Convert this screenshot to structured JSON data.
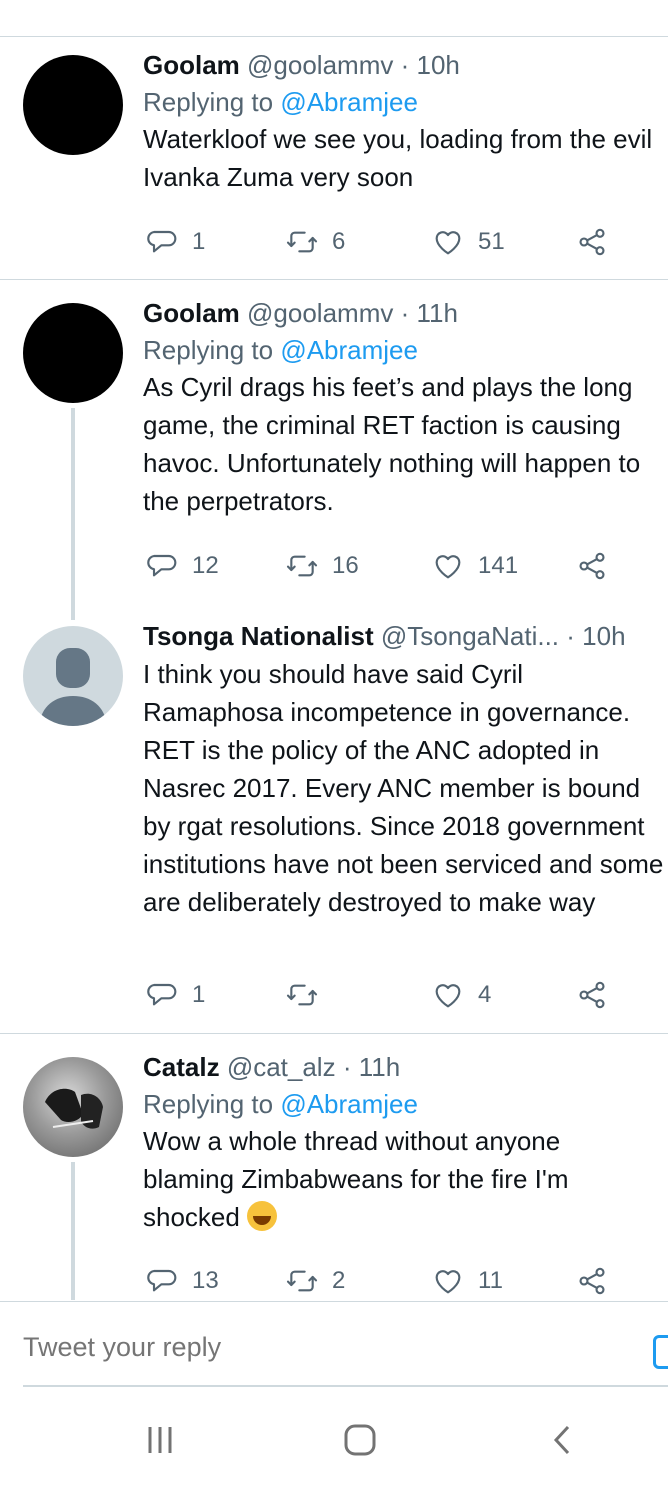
{
  "tweets": [
    {
      "name": "Goolam",
      "handle": "@goolammv",
      "dot": "·",
      "time": "10h",
      "replying_prefix": "Replying to ",
      "replying_to": "@Abramjee",
      "text": "Waterkloof we see you, loading from the evil Ivanka Zuma very soon",
      "replies": "1",
      "retweets": "6",
      "likes": "51",
      "avatar": "black"
    },
    {
      "name": "Goolam",
      "handle": "@goolammv",
      "dot": "·",
      "time": "11h",
      "replying_prefix": "Replying to ",
      "replying_to": "@Abramjee",
      "text": "As Cyril drags his feet’s and plays the long game, the criminal RET faction is causing havoc. Unfortunately nothing will happen to the perpetrators.",
      "replies": "12",
      "retweets": "16",
      "likes": "141",
      "avatar": "black"
    },
    {
      "name": "Tsonga Nationalist",
      "handle": "@TsongaNati...",
      "dot": "·",
      "time": "10h",
      "text": "I think you should have said Cyril Ramaphosa incompetence in governance. RET is the policy of the ANC adopted in Nasrec 2017. Every ANC member is bound by rgat resolutions. Since 2018 government institutions have not been serviced and some are deliberately destroyed to make way",
      "replies": "1",
      "retweets": "",
      "likes": "4",
      "avatar": "default-profile"
    },
    {
      "name": "Catalz",
      "handle": "@cat_alz",
      "dot": "·",
      "time": "11h",
      "replying_prefix": "Replying to ",
      "replying_to": "@Abramjee",
      "text": "Wow a whole thread without anyone blaming Zimbabweans for the fire I'm shocked",
      "emoji": "grinning-sweat-emoji",
      "replies": "13",
      "retweets": "2",
      "likes": "11",
      "avatar": "photo"
    }
  ],
  "composer": {
    "placeholder": "Tweet your reply",
    "camera_icon": "camera-icon"
  },
  "nav": {
    "recents": "recents-icon",
    "home": "home-icon",
    "back": "back-icon"
  },
  "colors": {
    "accent": "#1d9bf0",
    "secondary_text": "#536471",
    "divider": "#cfd9de"
  }
}
